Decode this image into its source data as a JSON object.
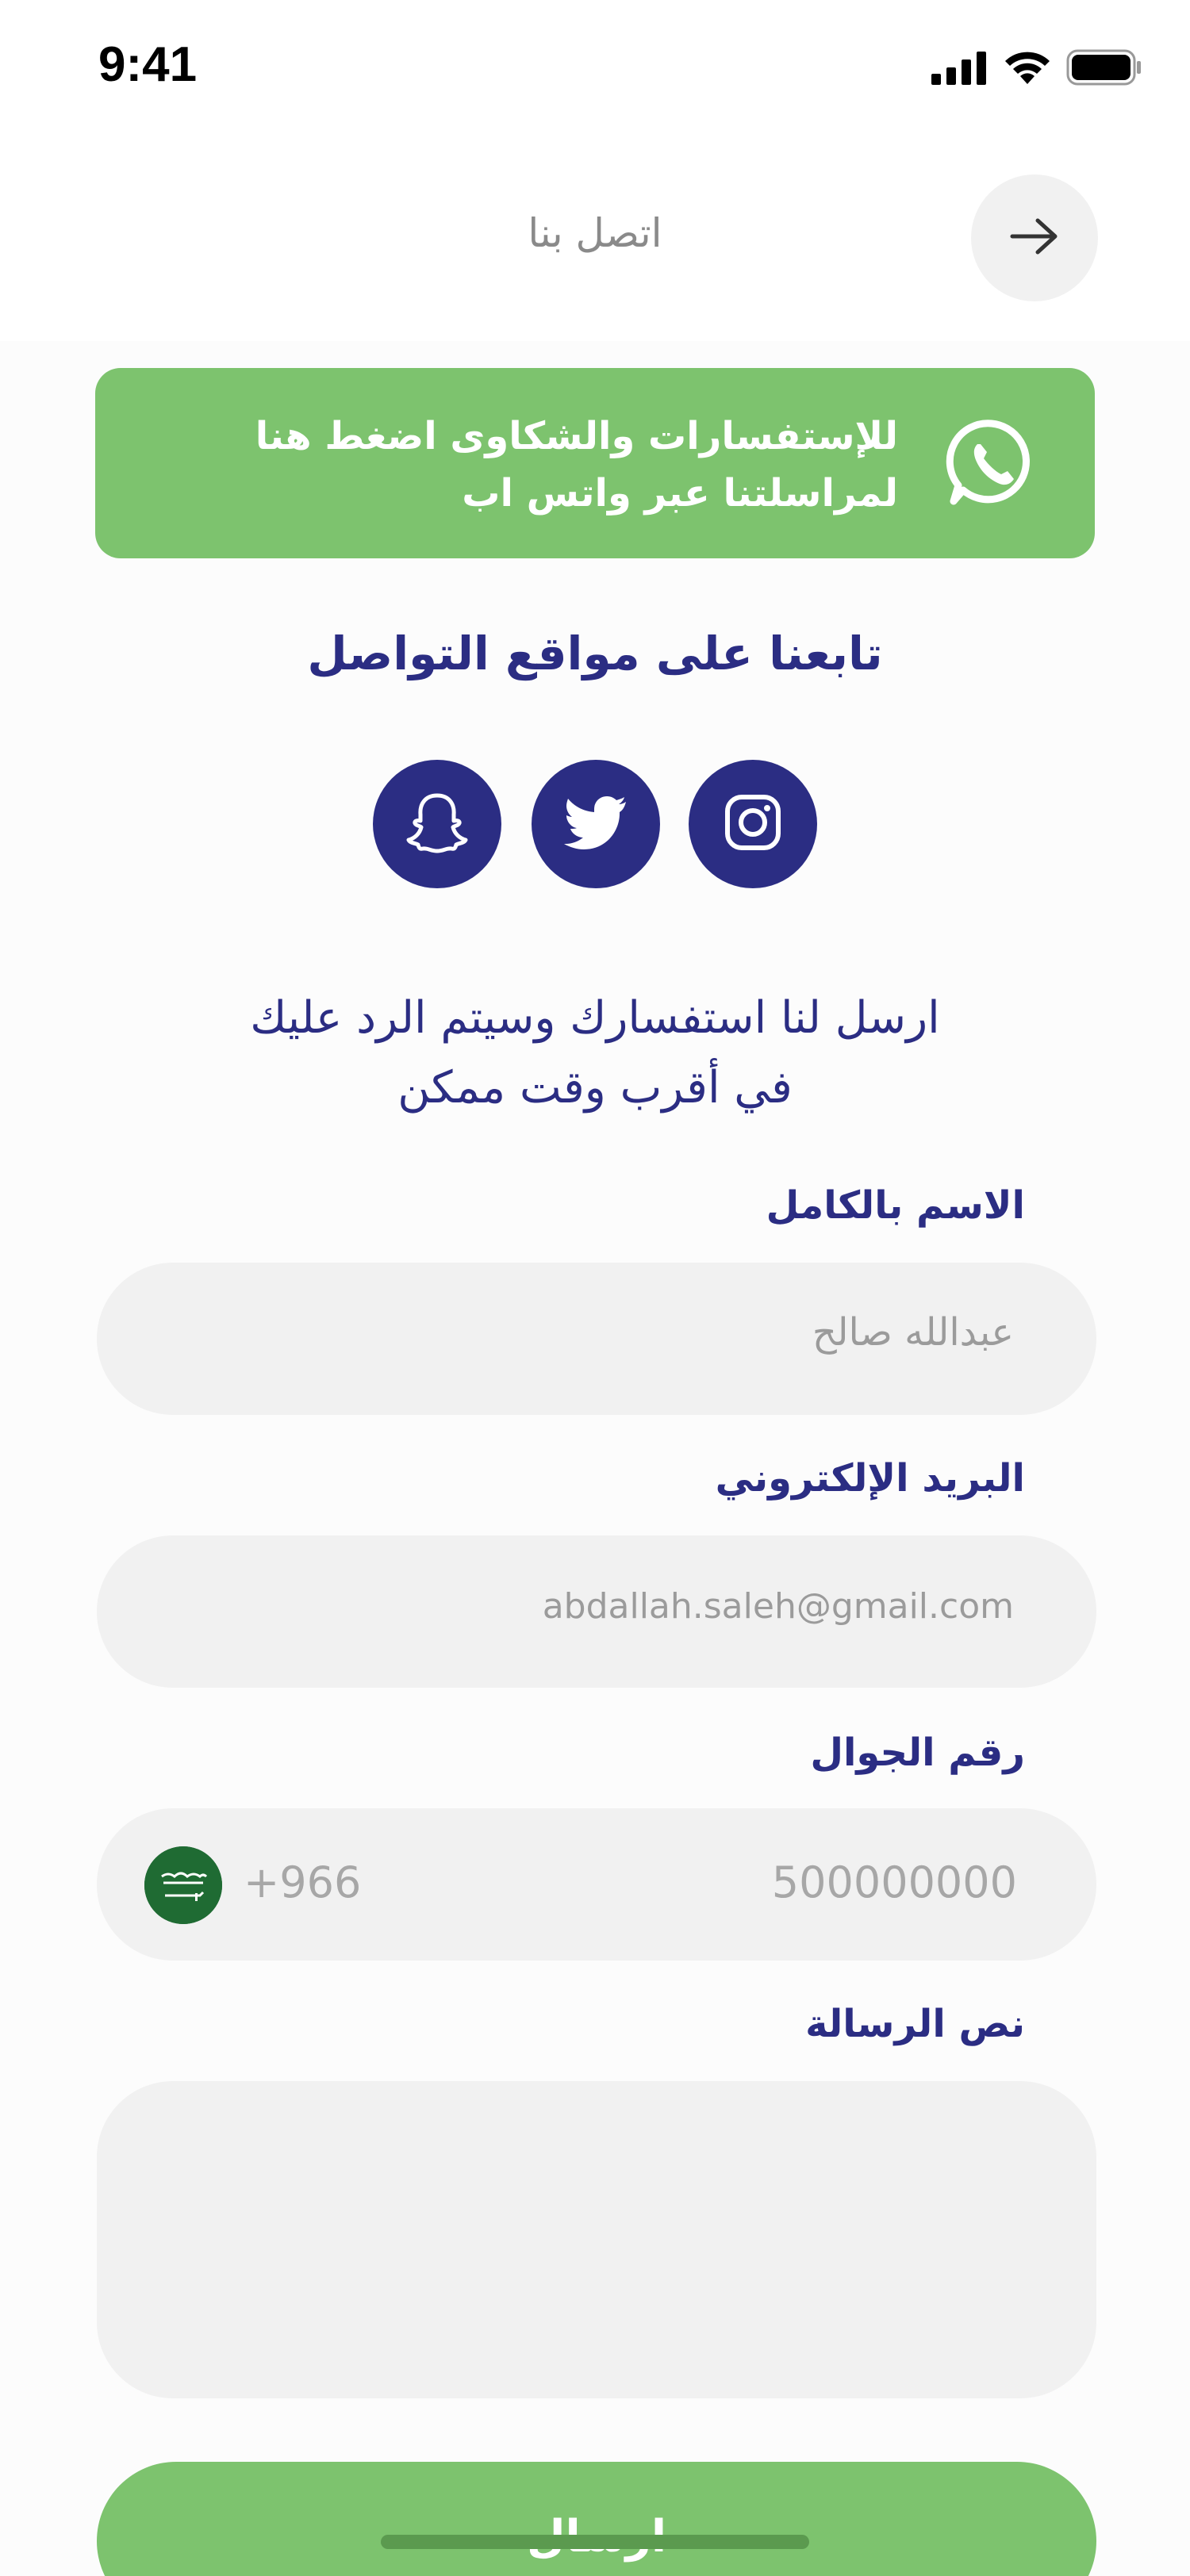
{
  "status_bar": {
    "time": "9:41"
  },
  "header": {
    "title": "اتصل بنا",
    "back_icon": "arrow-right-icon"
  },
  "whatsapp_banner": {
    "line1": "للإستفسارات والشكاوى اضغط هنا",
    "line2": "لمراسلتنا عبر واتس اب",
    "icon": "whatsapp-icon"
  },
  "social": {
    "title": "تابعنا على مواقع التواصل",
    "icons": [
      "snapchat-icon",
      "twitter-icon",
      "instagram-icon"
    ]
  },
  "intro": {
    "line1": "ارسل لنا استفسارك وسيتم الرد عليك",
    "line2": "في أقرب وقت ممكن"
  },
  "form": {
    "name_label": "الاسم بالكامل",
    "name_value": "عبدالله صالح",
    "email_label": "البريد الإلكتروني",
    "email_value": "abdallah.saleh@gmail.com",
    "phone_label": "رقم الجوال",
    "phone_code": "+966",
    "phone_value": "500000000",
    "message_label": "نص الرسالة",
    "message_value": ""
  },
  "submit": {
    "label": "ارسال"
  },
  "colors": {
    "brand_navy": "#2b2d83",
    "brand_green": "#7dc36e",
    "field_bg": "#f1f1f1"
  }
}
